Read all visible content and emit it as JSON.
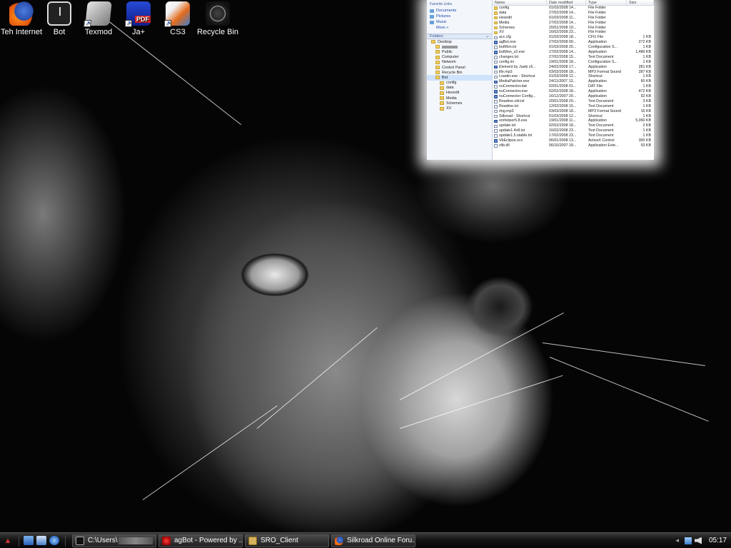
{
  "desktop": {
    "icons": [
      {
        "label": "Teh Internet",
        "icon": "firefox-icon"
      },
      {
        "label": "Bot",
        "icon": "clock-icon"
      },
      {
        "label": "Texmod",
        "icon": "texmod-icon"
      },
      {
        "label": "Ja+",
        "icon": "ja-plus-icon"
      },
      {
        "label": "CS3",
        "icon": "cs3-icon"
      },
      {
        "label": "Recycle Bin",
        "icon": "recycle-bin-icon"
      }
    ]
  },
  "explorer": {
    "favorite_links_heading": "Favorite Links",
    "favorite_links": [
      "Documents",
      "Pictures",
      "Music",
      "More »"
    ],
    "folders_heading": "Folders",
    "tree": [
      {
        "label": "Desktop",
        "level": 1
      },
      {
        "label": "",
        "level": 2,
        "redacted": true
      },
      {
        "label": "Public",
        "level": 2
      },
      {
        "label": "Computer",
        "level": 2
      },
      {
        "label": "Network",
        "level": 2
      },
      {
        "label": "Control Panel",
        "level": 2
      },
      {
        "label": "Recycle Bin",
        "level": 2
      },
      {
        "label": "Bot",
        "level": 2,
        "selected": true
      },
      {
        "label": "config",
        "level": 3
      },
      {
        "label": "data",
        "level": 3
      },
      {
        "label": "Hexedit",
        "level": 3
      },
      {
        "label": "Media",
        "level": 3
      },
      {
        "label": "Schemes",
        "level": 3
      },
      {
        "label": "XV",
        "level": 3
      }
    ],
    "columns": {
      "name": "Name",
      "date": "Date modified",
      "type": "Type",
      "size": "Size"
    },
    "files": [
      {
        "name": "config",
        "date": "01/03/2008 14...",
        "type": "File Folder",
        "size": "",
        "kind": "folder"
      },
      {
        "name": "data",
        "date": "27/02/2008 14...",
        "type": "File Folder",
        "size": "",
        "kind": "folder"
      },
      {
        "name": "Hexedit",
        "date": "01/03/2008 11...",
        "type": "File Folder",
        "size": "",
        "kind": "folder"
      },
      {
        "name": "Media",
        "date": "27/02/2008 14...",
        "type": "File Folder",
        "size": "",
        "kind": "folder"
      },
      {
        "name": "Schemes",
        "date": "20/01/2008 19...",
        "type": "File Folder",
        "size": "",
        "kind": "folder"
      },
      {
        "name": "XV",
        "date": "16/02/2008 23...",
        "type": "File Folder",
        "size": "",
        "kind": "folder"
      },
      {
        "name": "acc.cfg",
        "date": "01/03/2008 18...",
        "type": "CFG File",
        "size": "1 KB",
        "kind": "file"
      },
      {
        "name": "agBot.exe",
        "date": "27/02/2008 00...",
        "type": "Application",
        "size": "272 KB",
        "kind": "app"
      },
      {
        "name": "botMon.ini",
        "date": "01/03/2008 20...",
        "type": "Configuration S...",
        "size": "1 KB",
        "kind": "file"
      },
      {
        "name": "botMon_v2.exe",
        "date": "27/02/2008 14...",
        "type": "Application",
        "size": "1,480 KB",
        "kind": "app"
      },
      {
        "name": "changes.txt",
        "date": "27/02/2008 15...",
        "type": "Text Document",
        "size": "1 KB",
        "kind": "file"
      },
      {
        "name": "config.ini",
        "date": "19/01/2008 18...",
        "type": "Configuration S...",
        "size": "1 KB",
        "kind": "file"
      },
      {
        "name": "Element by Jueki v5...",
        "date": "24/02/2008 17...",
        "type": "Application",
        "size": "281 KB",
        "kind": "app"
      },
      {
        "name": "life.mp3",
        "date": "03/03/2008 18...",
        "type": "MP3 Format Sound",
        "size": "287 KB",
        "kind": "file"
      },
      {
        "name": "Loader.exe - Shortcut",
        "date": "01/03/2008 12...",
        "type": "Shortcut",
        "size": "1 KB",
        "kind": "file"
      },
      {
        "name": "MediaPatcher.exe",
        "date": "24/11/2007 13...",
        "type": "Application",
        "size": "60 KB",
        "kind": "app"
      },
      {
        "name": "nuConnector.dat",
        "date": "02/01/2008 01...",
        "type": "DAT File",
        "size": "1 KB",
        "kind": "file"
      },
      {
        "name": "nuConnector.exe",
        "date": "02/02/2008 18...",
        "type": "Application",
        "size": "472 KB",
        "kind": "app"
      },
      {
        "name": "nuConnector Config...",
        "date": "16/12/2007 20...",
        "type": "Application",
        "size": "52 KB",
        "kind": "app"
      },
      {
        "name": "Readme.old.txt",
        "date": "20/01/2008 20...",
        "type": "Text Document",
        "size": "3 KB",
        "kind": "file"
      },
      {
        "name": "Readme.txt",
        "date": "12/02/2008 15...",
        "type": "Text Document",
        "size": "1 KB",
        "kind": "file"
      },
      {
        "name": "ring.mp3",
        "date": "03/03/2008 18...",
        "type": "MP3 Format Sound",
        "size": "16 KB",
        "kind": "file"
      },
      {
        "name": "Silkroad - Shortcut",
        "date": "01/03/2008 12...",
        "type": "Shortcut",
        "size": "1 KB",
        "kind": "file"
      },
      {
        "name": "srohelper5.8.exe",
        "date": "19/01/2008 11...",
        "type": "Application",
        "size": "5,060 KB",
        "kind": "app"
      },
      {
        "name": "update.txt",
        "date": "02/02/2008 18...",
        "type": "Text Document",
        "size": "2 KB",
        "kind": "file"
      },
      {
        "name": "update1.4v8.txt",
        "date": "16/02/2008 23...",
        "type": "Text Document",
        "size": "1 KB",
        "kind": "file"
      },
      {
        "name": "update1.5.stable.txt",
        "date": "17/02/2008 23...",
        "type": "Text Document",
        "size": "1 KB",
        "kind": "file"
      },
      {
        "name": "VbEclipse.ocx",
        "date": "06/01/2008 13...",
        "type": "ActiveX Control",
        "size": "300 KB",
        "kind": "app"
      },
      {
        "name": "zlib.dll",
        "date": "06/10/2007 18...",
        "type": "Application Exte...",
        "size": "53 KB",
        "kind": "file"
      }
    ]
  },
  "taskbar": {
    "start_icon": "start-orb-icon",
    "quick_launch": [
      "show-desktop-icon",
      "switch-windows-icon",
      "internet-explorer-icon"
    ],
    "tasks": [
      {
        "label": "C:\\Users\\",
        "icon": "command-prompt-icon",
        "redacted_suffix": true
      },
      {
        "label": "agBot - Powered by ...",
        "icon": "agbot-icon"
      },
      {
        "label": "SRO_Client",
        "icon": "sro-client-icon"
      },
      {
        "label": "Silkroad Online Foru...",
        "icon": "firefox-icon"
      }
    ],
    "tray_icons": [
      "chevron-icon",
      "network-icon",
      "volume-icon"
    ],
    "clock": "05:17"
  }
}
